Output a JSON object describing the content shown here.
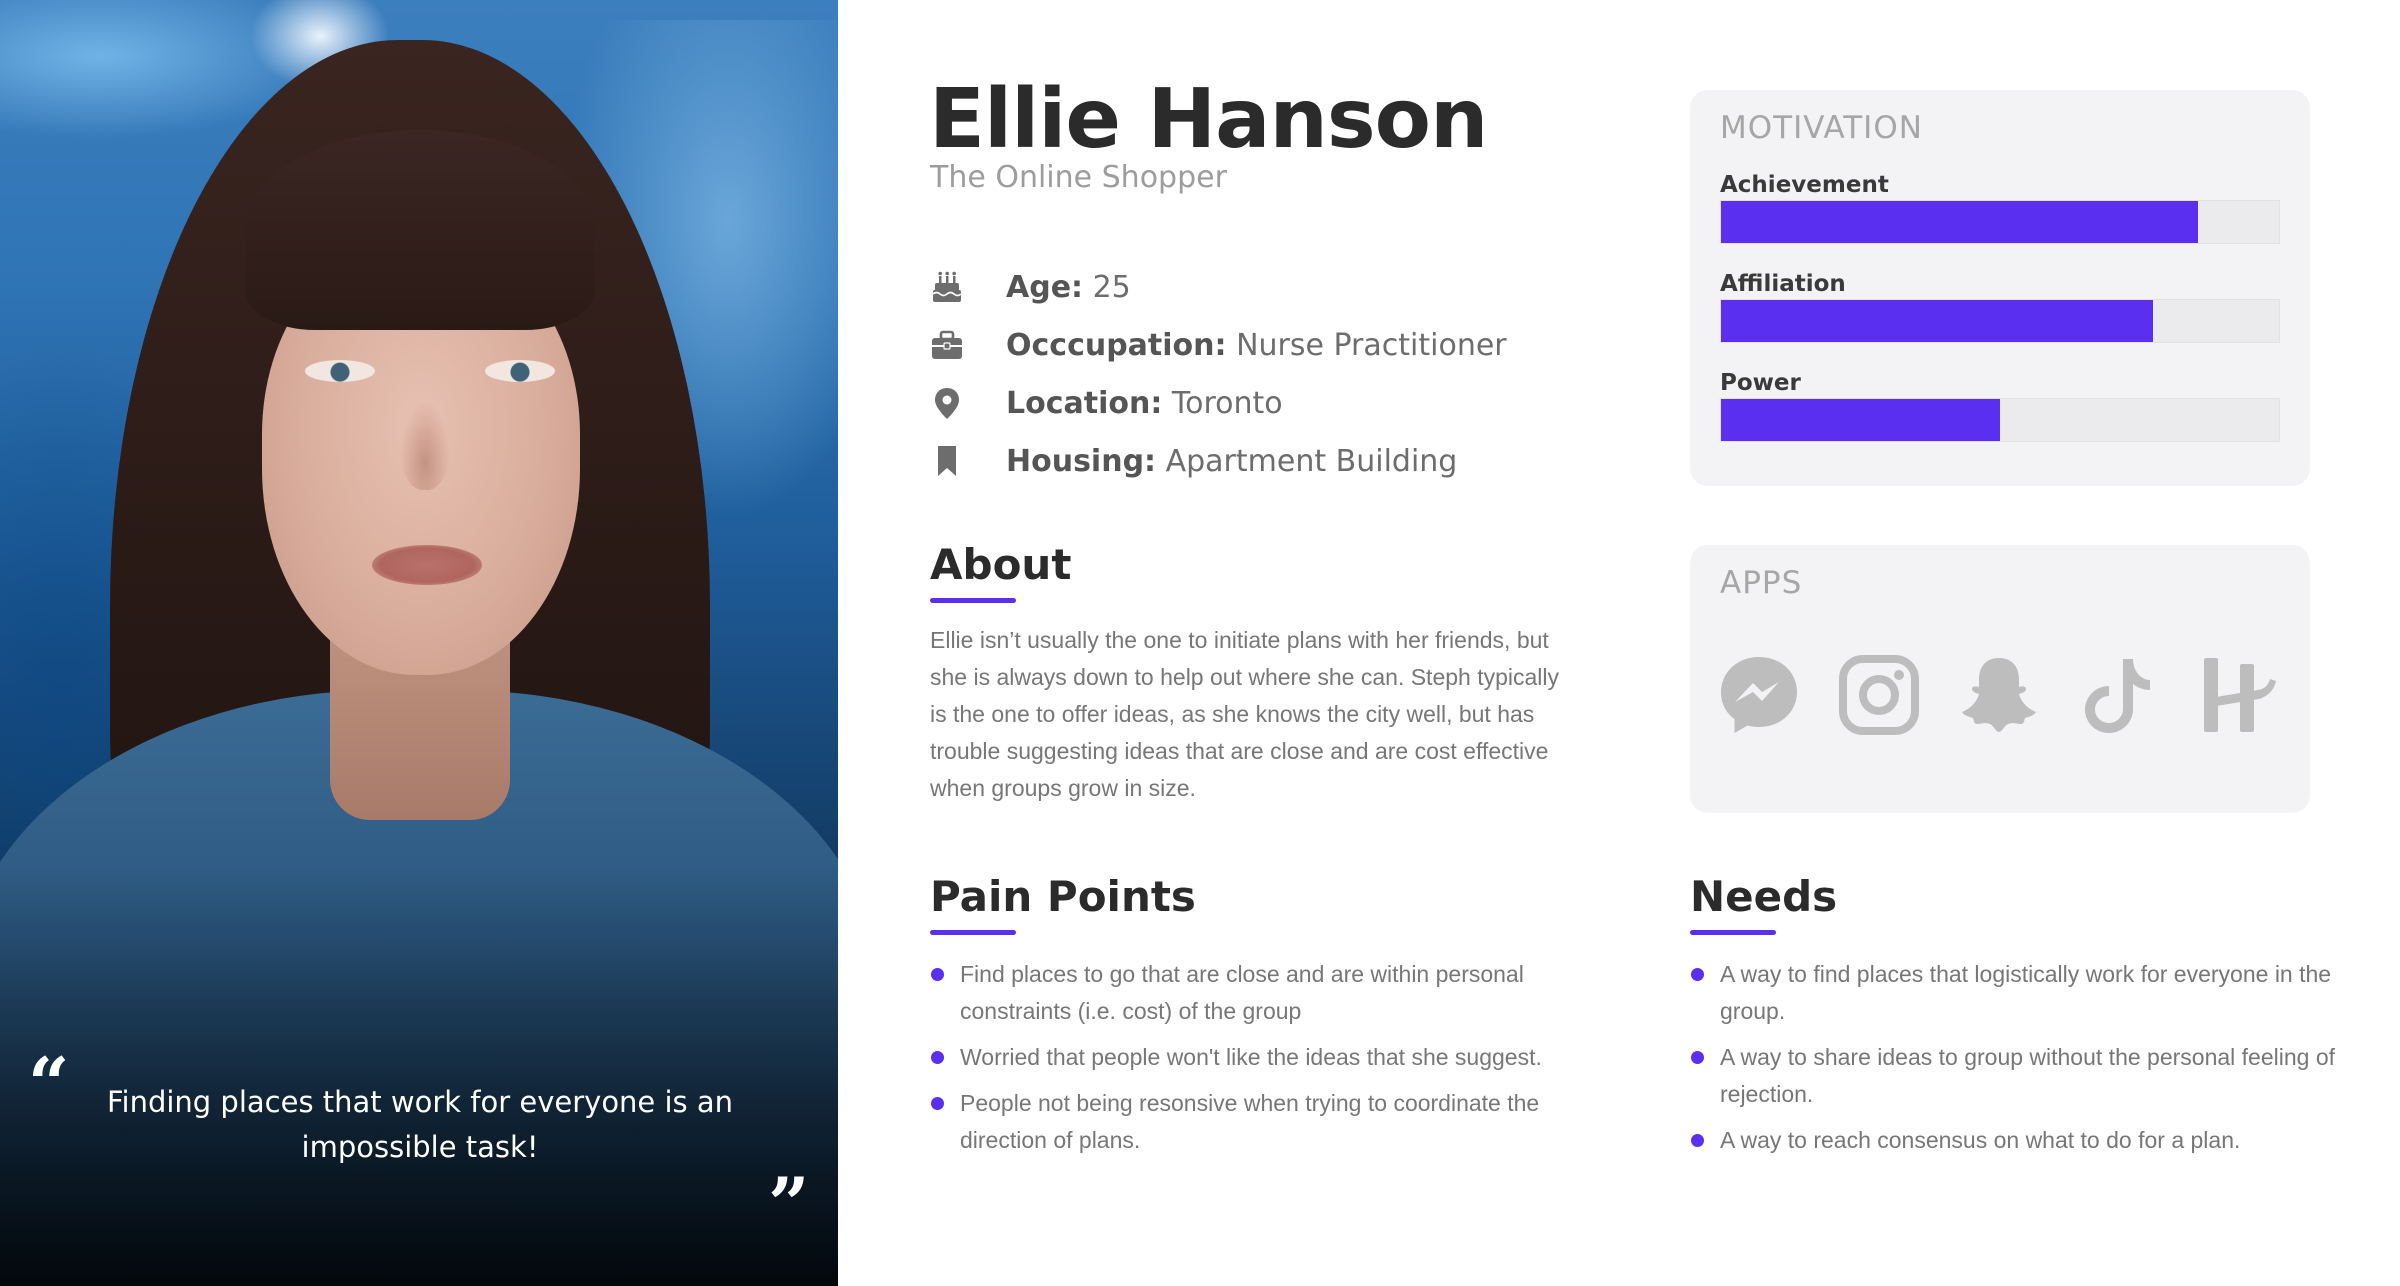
{
  "persona": {
    "name": "Ellie Hanson",
    "subtitle": "The Online Shopper",
    "quote": "Finding places that work for everyone is an impossible task!"
  },
  "info": [
    {
      "icon": "cake-icon",
      "label": "Age:",
      "value": "25"
    },
    {
      "icon": "briefcase-icon",
      "label": "Occcupation:",
      "value": "Nurse Practitioner"
    },
    {
      "icon": "location-pin-icon",
      "label": "Location:",
      "value": "Toronto"
    },
    {
      "icon": "bookmark-icon",
      "label": "Housing:",
      "value": "Apartment Building"
    }
  ],
  "about": {
    "title": "About",
    "text": "Ellie isn’t usually the one to initiate plans with her friends, but she is always down to help out where she can. Steph typically is the one to offer ideas, as she knows the city well, but has trouble suggesting ideas that are close and are cost effective when groups grow in size."
  },
  "pain_points": {
    "title": "Pain Points",
    "items": [
      "Find places to go that are close and are within personal constraints (i.e. cost) of the group",
      "Worried that people won't like the ideas that she suggest.",
      "People not being resonsive when trying to coordinate the direction of plans."
    ]
  },
  "needs": {
    "title": "Needs",
    "items": [
      "A way to find places that logistically work for everyone in the group.",
      "A way to share ideas to group without the personal feeling of rejection.",
      "A way to reach consensus on what to do for a plan."
    ]
  },
  "motivation": {
    "title": "MOTIVATION",
    "bars": [
      {
        "label": "Achievement",
        "level": 0.855
      },
      {
        "label": "Affiliation",
        "level": 0.775
      },
      {
        "label": "Power",
        "level": 0.5
      }
    ]
  },
  "apps": {
    "title": "APPS",
    "items": [
      "messenger-icon",
      "instagram-icon",
      "snapchat-icon",
      "tiktok-icon",
      "houseparty-icon"
    ]
  },
  "colors": {
    "accent": "#5b2ff0",
    "card_bg": "#f3f3f5",
    "heading": "#2b2b2b",
    "muted": "#9d9d9d",
    "app_icon": "#bdbdbd"
  }
}
